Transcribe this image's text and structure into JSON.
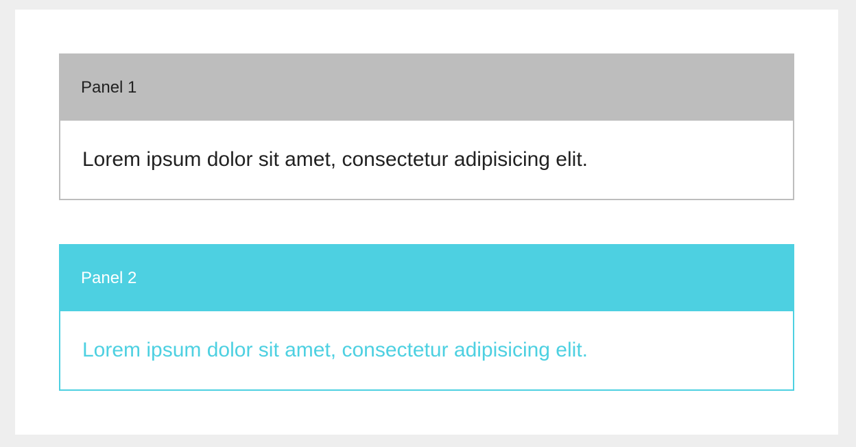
{
  "colors": {
    "page_background": "#eeeeee",
    "card_background": "#ffffff",
    "panel_1_header": "#bdbdbd",
    "panel_1_border": "#bdbdbd",
    "panel_1_text": "#212121",
    "panel_2_header": "#4dd0e1",
    "panel_2_border": "#4dd0e1",
    "panel_2_title_text": "#ffffff",
    "panel_2_body_text": "#4dd0e1"
  },
  "panels": [
    {
      "title": "Panel 1",
      "body": "Lorem ipsum dolor sit amet, consectetur adipisicing elit."
    },
    {
      "title": "Panel 2",
      "body": "Lorem ipsum dolor sit amet, consectetur adipisicing elit."
    }
  ]
}
